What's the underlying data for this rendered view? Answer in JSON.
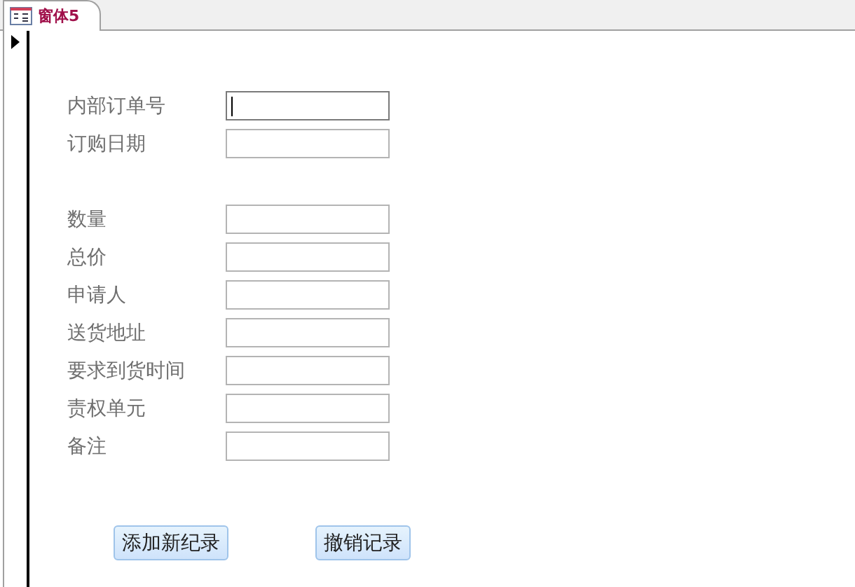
{
  "tab": {
    "title": "窗体5",
    "selected": true
  },
  "field_groups": [
    {
      "fields": [
        {
          "label": "内部订单号",
          "focused": true
        },
        {
          "label": "订购日期",
          "focused": false
        }
      ]
    },
    {
      "fields": [
        {
          "label": "数量",
          "focused": false
        },
        {
          "label": "总价",
          "focused": false
        },
        {
          "label": "申请人",
          "focused": false
        },
        {
          "label": "送货地址",
          "focused": false
        },
        {
          "label": "要求到货时间",
          "focused": false
        },
        {
          "label": "责权单元",
          "focused": false
        },
        {
          "label": "备注",
          "focused": false
        }
      ]
    }
  ],
  "buttons": [
    "添加新纪录",
    "撤销记录"
  ]
}
